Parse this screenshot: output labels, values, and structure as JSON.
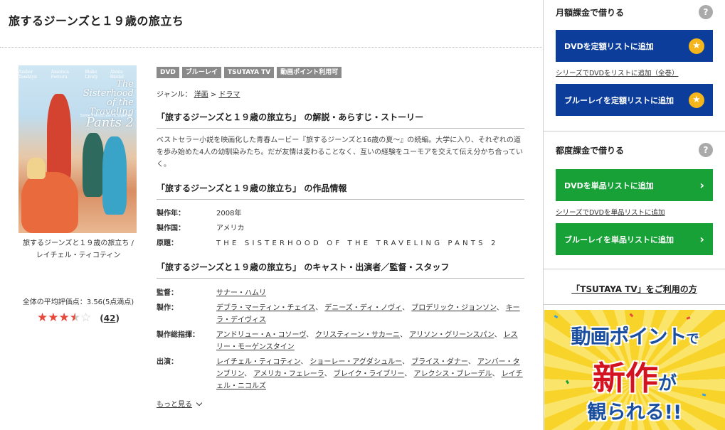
{
  "page": {
    "title": "旅するジーンズと１９歳の旅立ち"
  },
  "poster": {
    "actor_names": [
      "Amber Tamblyn",
      "America Ferrera",
      "Blake Lively",
      "Alexis Bledel"
    ],
    "title_line1": "The",
    "title_line2": "Sisterhood",
    "title_line3": "of the Traveling",
    "title_line4": "Pants 2",
    "tagline": "Some friends just fit together"
  },
  "left": {
    "caption_line1": "旅するジーンズと１９歳の旅立ち /",
    "caption_line2": "レイチェル・ティコティン",
    "rating_label": "全体の平均評価点：3.56(5点満点)",
    "rating_value": 3.5,
    "rating_count_open": "(",
    "rating_count": "42",
    "rating_count_close": ")"
  },
  "badges": [
    "DVD",
    "ブルーレイ",
    "TSUTAYA TV",
    "動画ポイント利用可"
  ],
  "genre": {
    "label": "ジャンル：",
    "level1": "洋画",
    "sep": " > ",
    "level2": "ドラマ"
  },
  "synopsis": {
    "heading": "「旅するジーンズと１９歳の旅立ち」 の解説・あらすじ・ストーリー",
    "text": "ベストセラー小説を映画化した青春ムービー『旅するジーンズと16歳の夏～』の続編。大学に入り、それぞれの道を歩み始めた4人の幼馴染みたち。だが友情は変わることなく、互いの経験をユーモアを交えて伝え分かち合っていく。"
  },
  "info": {
    "heading": "「旅するジーンズと１９歳の旅立ち」 の作品情報",
    "rows": [
      {
        "k": "製作年：",
        "v": "2008年"
      },
      {
        "k": "製作国：",
        "v": "アメリカ"
      },
      {
        "k": "原題：",
        "v": "THE SISTERHOOD OF THE TRAVELING PANTS 2"
      }
    ]
  },
  "cast": {
    "heading": "「旅するジーンズと１９歳の旅立ち」 のキャスト・出演者／監督・スタッフ",
    "director_label": "監督：",
    "director": "サナー・ハムリ",
    "producer_label": "製作：",
    "producers": [
      "デブラ・マーティン・チェイス",
      "デニーズ・ディ・ノヴィ",
      "ブロデリック・ジョンソン",
      "キーラ・デイヴィス"
    ],
    "exec_label": "製作総指揮：",
    "execs": [
      "アンドリュー・A・コソーヴ",
      "クリスティーン・サカーニ",
      "アリソン・グリーンスパン",
      "レスリー・モーゲンスタイン"
    ],
    "actors_label": "出演：",
    "actors": [
      "レイチェル・ティコティン",
      "ショーレー・アグダシュルー",
      "ブライス・ダナー",
      "アンバー・タンブリン",
      "アメリカ・フェレーラ",
      "ブレイク・ライブリー",
      "アレクシス・ブレーデル",
      "レイチェル・ニコルズ"
    ],
    "sep": "、",
    "more": "もっと見る"
  },
  "sidebar": {
    "monthly_title": "月額課金で借りる",
    "help": "?",
    "btn_dvd_monthly": "DVDを定額リストに追加",
    "link_series_monthly": "シリーズでDVDをリストに追加（全巻）",
    "btn_bd_monthly": "ブルーレイを定額リストに追加",
    "single_title": "都度課金で借りる",
    "btn_dvd_single": "DVDを単品リストに追加",
    "link_series_single": "シリーズでDVDを単品リストに追加",
    "btn_bd_single": "ブルーレイを単品リストに追加",
    "tv_link": "「TSUTAYA TV」をご利用の方",
    "banner_line1a": "動画ポイント",
    "banner_line1b": "で",
    "banner_line2a": "新作",
    "banner_line2b": "が",
    "banner_line3": "観られる!!"
  },
  "colors": {
    "blue_button": "#0d3d9b",
    "green_button": "#18a137",
    "star": "#e8483c",
    "badge": "#8a8a8a",
    "banner_bg": "#f8d42a"
  }
}
